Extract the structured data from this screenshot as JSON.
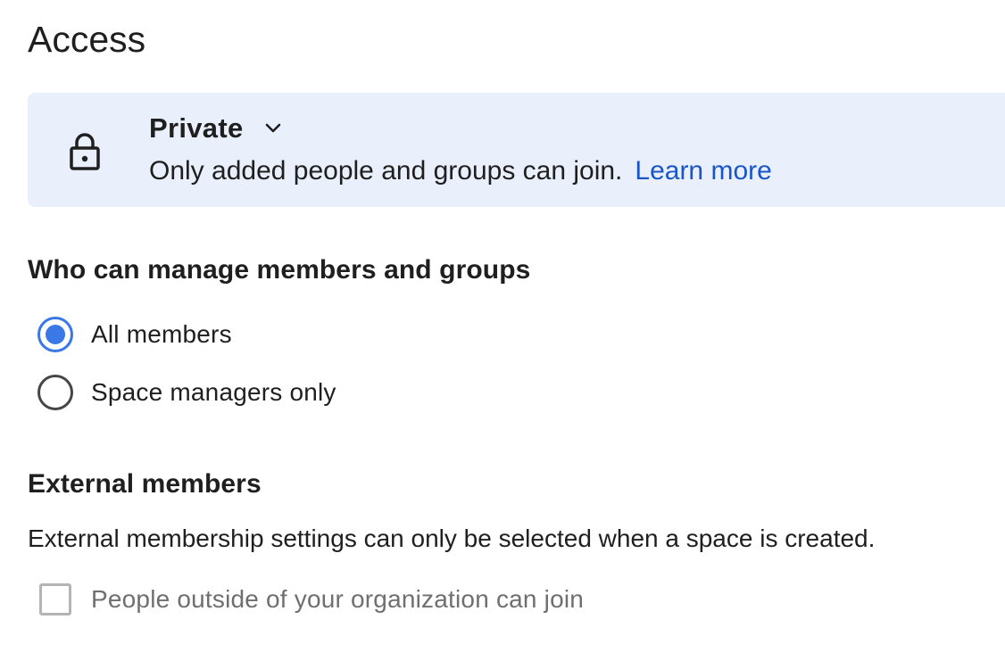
{
  "access": {
    "heading": "Access",
    "card": {
      "lock_icon": "lock-icon",
      "type_label": "Private",
      "chevron_icon": "chevron-down-icon",
      "description": "Only added people and groups can join.",
      "learn_more": "Learn more"
    }
  },
  "manage": {
    "title": "Who can manage members and groups",
    "options": [
      {
        "label": "All members",
        "selected": true
      },
      {
        "label": "Space managers only",
        "selected": false
      }
    ]
  },
  "external": {
    "title": "External members",
    "description": "External membership settings can only be selected when a space is created.",
    "checkbox_label": "People outside of your organization can join",
    "checkbox_checked": false,
    "checkbox_disabled": true
  },
  "colors": {
    "card_background": "#e9f0fc",
    "accent": "#3a78e6",
    "link": "#1a56c8",
    "disabled_text": "#6f6f6f"
  }
}
